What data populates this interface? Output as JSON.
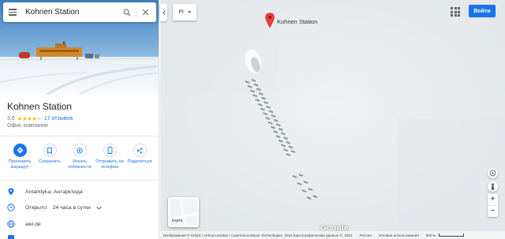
{
  "search": {
    "value": "Kohnen Station"
  },
  "place": {
    "title": "Kohnen Station",
    "rating": "3,6",
    "stars": "★★★★",
    "stars_empty": "★",
    "reviews": "17 отзывов",
    "category": "Офис компании"
  },
  "actions": [
    {
      "label": "Проложить маршрут",
      "icon": "directions-icon"
    },
    {
      "label": "Сохранить",
      "icon": "bookmark-icon"
    },
    {
      "label": "Искать поблизости",
      "icon": "nearby-icon"
    },
    {
      "label": "Отправить на телефон",
      "icon": "phone-icon"
    },
    {
      "label": "Поделиться",
      "icon": "share-icon"
    }
  ],
  "info": {
    "address": "Antarktyka, Антарктида",
    "hours_label": "Открыто:",
    "hours_value": "24 часа в сутки",
    "website": "awi.de"
  },
  "map": {
    "layer_select": "Рг",
    "marker_label": "Kohnen Station",
    "signin_label": "Войти",
    "layers_thumb_label": "Карта",
    "google_logo": "Google",
    "attribution": "Изображения © CNES / Airbus,Landsat / Copernicus,Maxar Technologies, 2021,Картографические данные ©, 2021",
    "country": "Россия",
    "terms": "Условия использования",
    "scale": "900 м"
  },
  "colors": {
    "accent": "#1a73e8",
    "star": "#fbbc04",
    "marker": "#ea4335"
  }
}
